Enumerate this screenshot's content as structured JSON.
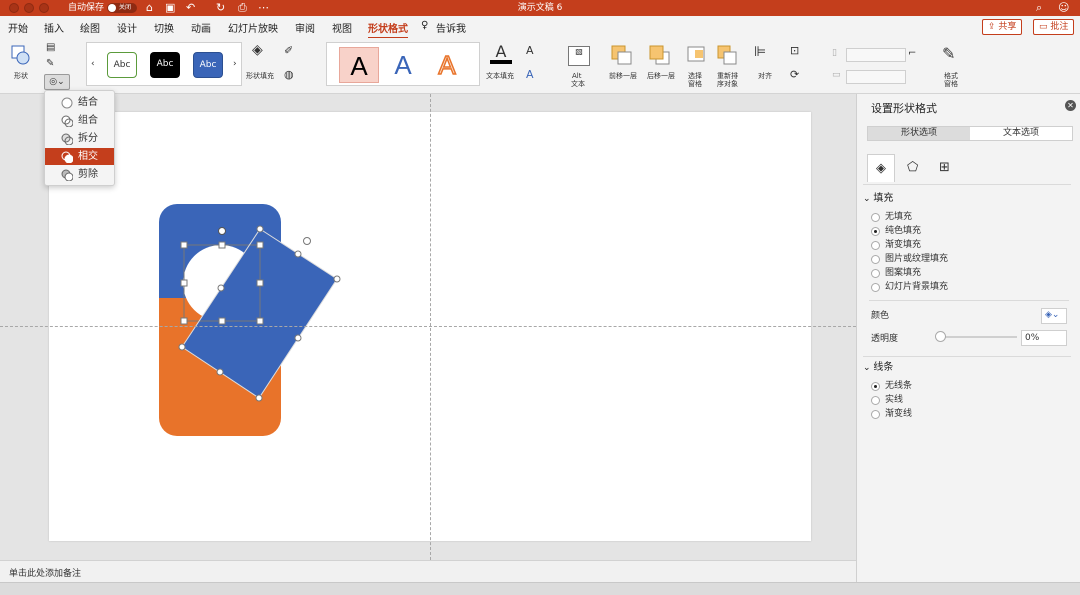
{
  "app": {
    "autosave_label": "自动保存",
    "autosave_state": "关闭",
    "document_title": "演示文稿 6",
    "accent_color": "#c43e1c"
  },
  "menu": {
    "tabs": [
      "开始",
      "插入",
      "绘图",
      "设计",
      "切换",
      "动画",
      "幻灯片放映",
      "审阅",
      "视图",
      "形状格式"
    ],
    "active_tab": "形状格式",
    "tell_me": "告诉我",
    "share": "共享",
    "comments": "批注"
  },
  "ribbon": {
    "shape_label": "形状",
    "style_presets": [
      "Abc",
      "Abc",
      "Abc"
    ],
    "shape_fill_label": "形状填充",
    "wordart_letters": [
      "A",
      "A",
      "A"
    ],
    "text_fill_label": "文本填充",
    "alt_text_label_1": "Alt",
    "alt_text_label_2": "文本",
    "bring_forward": "前移一层",
    "send_backward": "后移一层",
    "selection_pane_1": "选择",
    "selection_pane_2": "窗格",
    "reorder_1": "重新排",
    "reorder_2": "序对象",
    "align": "对齐",
    "format_pane_1": "格式",
    "format_pane_2": "窗格"
  },
  "merge_menu": {
    "items": [
      "结合",
      "组合",
      "拆分",
      "相交",
      "剪除"
    ],
    "selected": "相交"
  },
  "slide": {
    "shapes": {
      "rounded_rect_top_color": "#3a65b8",
      "rounded_rect_bottom_color": "#e8732a",
      "rotated_rect_color": "#3a65b8",
      "circle_color": "#ffffff"
    }
  },
  "notes": {
    "placeholder": "单击此处添加备注"
  },
  "format_pane": {
    "title": "设置形状格式",
    "tab_shape": "形状选项",
    "tab_text": "文本选项",
    "fill_section": "填充",
    "fill_options": [
      "无填充",
      "纯色填充",
      "渐变填充",
      "图片或纹理填充",
      "图案填充",
      "幻灯片背景填充"
    ],
    "fill_selected": "纯色填充",
    "color_label": "颜色",
    "transparency_label": "透明度",
    "transparency_value": "0%",
    "line_section": "线条",
    "line_options": [
      "无线条",
      "实线",
      "渐变线"
    ],
    "line_selected": "无线条"
  }
}
